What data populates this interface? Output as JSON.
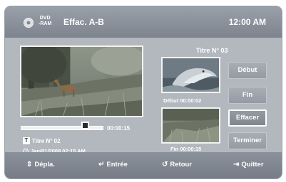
{
  "header": {
    "disc_line1": "DVD",
    "disc_line2": "-RAM",
    "title": "Effac. A-B",
    "clock": "12:00 AM"
  },
  "player": {
    "time": "00:00:15",
    "progress": 0.78,
    "title_badge": "T",
    "title_name": "Titre N° 02",
    "date": "Jan/01/2008 02:15 AM"
  },
  "edit": {
    "title_label": "Titre N° 03",
    "start_caption": "Début  00:00:02",
    "end_caption": "Fin 00:00:15"
  },
  "buttons": {
    "start": "Début",
    "end": "Fin",
    "erase": "Effacer",
    "finish": "Terminer",
    "selected": "erase"
  },
  "footer": {
    "move": "Dépla.",
    "enter": "Entrée",
    "return": "Retour",
    "quit": "Quitter"
  },
  "colors": {
    "panel": "#b3b8bf",
    "bar": "#7d848e",
    "text": "#ffffff"
  },
  "icons": {
    "disc": "disc-icon",
    "title": "title-icon",
    "clock": "clock-icon",
    "move": "up-down-arrow-icon",
    "enter": "enter-icon",
    "return": "return-arrow-icon",
    "quit": "exit-door-icon"
  }
}
